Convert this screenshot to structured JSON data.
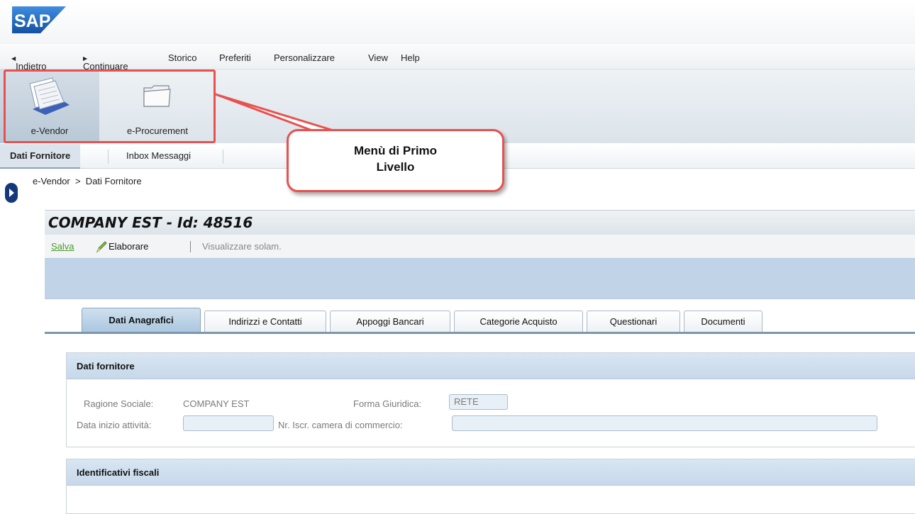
{
  "logo": {
    "text": "SAP"
  },
  "menubar": {
    "back": "Indietro",
    "forward": "Continuare",
    "items": [
      "Storico",
      "Preferiti",
      "Personalizzare",
      "View",
      "Help"
    ]
  },
  "topnav": {
    "items": [
      {
        "label": "e-Vendor",
        "icon": "documents-icon",
        "active": true
      },
      {
        "label": "e-Procurement",
        "icon": "folder-icon",
        "active": false
      }
    ]
  },
  "subnav": {
    "items": [
      "Dati Fornitore",
      "Inbox Messaggi"
    ]
  },
  "breadcrumb": {
    "text": "e-Vendor  >  Dati Fornitore"
  },
  "callout": {
    "line1": "Menù di Primo",
    "line2": "Livello"
  },
  "page": {
    "title": "COMPANY EST - Id: 48516",
    "toolbar": {
      "save": "Salva",
      "edit": "Elaborare",
      "view": "Visualizzare solam."
    },
    "tabs": [
      "Dati Anagrafici",
      "Indirizzi e Contatti",
      "Appoggi Bancari",
      "Categorie Acquisto",
      "Questionari",
      "Documenti"
    ],
    "group1": {
      "title": "Dati fornitore",
      "ragione_label": "Ragione Sociale:",
      "ragione_value": "COMPANY EST",
      "forma_label": "Forma Giuridica:",
      "forma_value": "RETE",
      "data_label": "Data inizio attività:",
      "data_value": "",
      "nr_label": "Nr. Iscr. camera di commercio:",
      "nr_value": ""
    },
    "group2": {
      "title": "Identificativi fiscali"
    }
  },
  "colors": {
    "accent_red": "#e8514f",
    "sap_blue": "#1b5fae",
    "header_blue": "#c1d4e7"
  }
}
